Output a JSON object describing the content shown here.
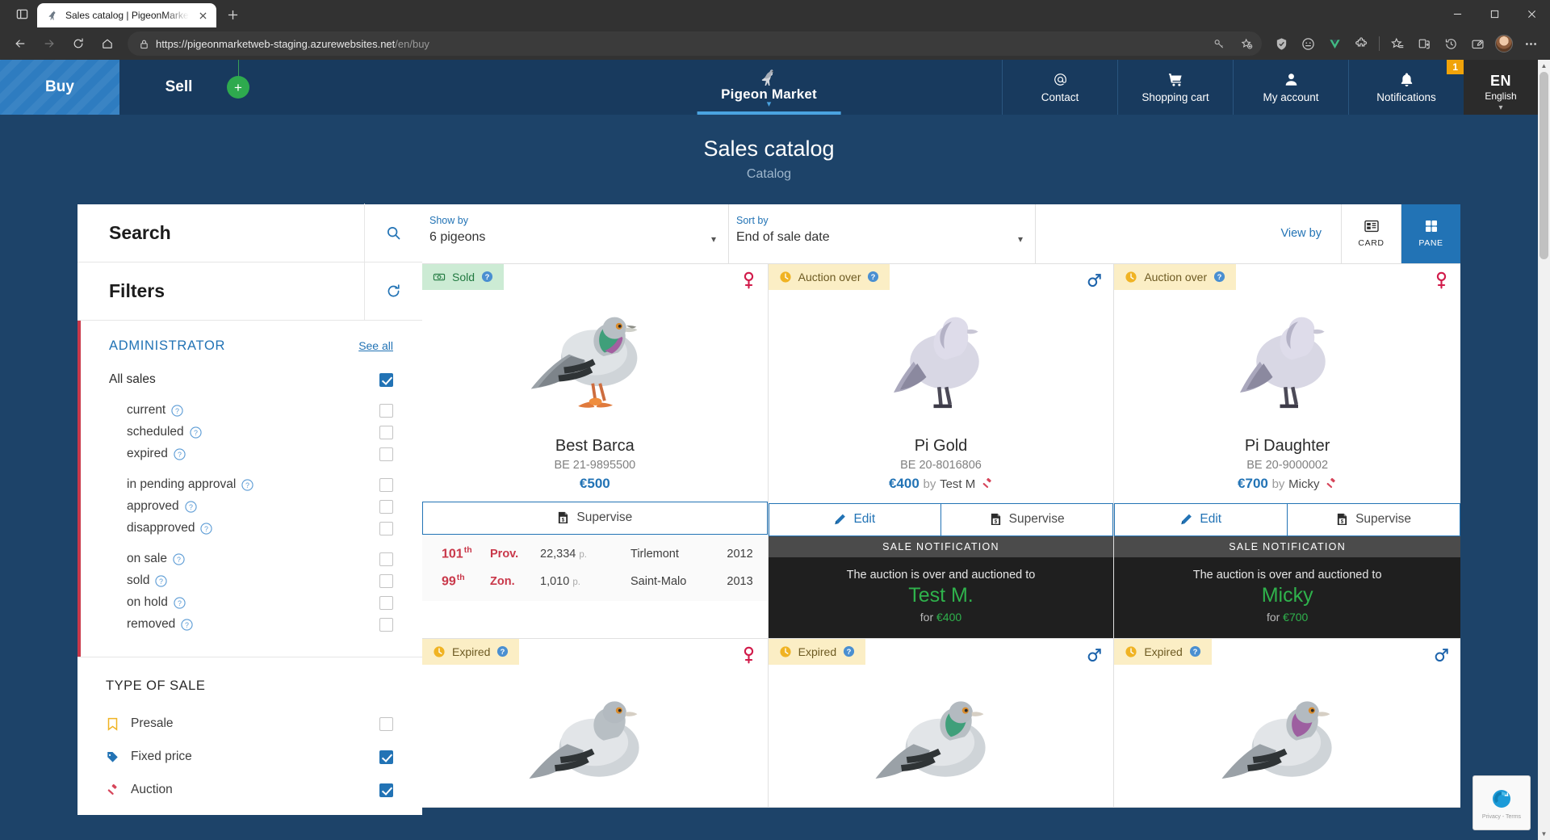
{
  "browser": {
    "tab": {
      "title": "Sales catalog | PigeonMarket - B",
      "favicon": "pigeon-icon"
    },
    "new_tab_label": "+",
    "url_secure": "https://pigeonmarketweb-staging.azurewebsites.net",
    "url_path": "/en/buy",
    "toolbar_icons": [
      "key-icon",
      "add-favorite-icon",
      "shield-icon",
      "emoji-icon",
      "vue-devtools-icon",
      "extensions-icon",
      "favorites-icon",
      "collections-icon",
      "history-icon",
      "screenshot-icon",
      "profile-avatar",
      "more-icon"
    ],
    "window_controls": [
      "minimize",
      "maximize",
      "close"
    ],
    "nav_icons": [
      "back-arrow-icon",
      "forward-arrow-icon",
      "reload-icon",
      "home-icon"
    ]
  },
  "site_nav": {
    "buy": "Buy",
    "sell": "Sell",
    "add_label": "+",
    "brand": "Pigeon Market",
    "items": [
      {
        "label": "Contact",
        "icon": "at-icon"
      },
      {
        "label": "Shopping cart",
        "icon": "cart-icon"
      },
      {
        "label": "My account",
        "icon": "user-icon"
      },
      {
        "label": "Notifications",
        "icon": "bell-icon",
        "badge": "1"
      }
    ],
    "language": {
      "code": "EN",
      "name": "English"
    }
  },
  "page_header": {
    "title": "Sales catalog",
    "subtitle": "Catalog"
  },
  "sidebar": {
    "search": {
      "title": "Search",
      "icon": "search-icon"
    },
    "filters": {
      "title": "Filters",
      "icon": "refresh-icon"
    },
    "administrator": {
      "title": "ADMINISTRATOR",
      "see_all": "See all",
      "all_sales": {
        "label": "All sales",
        "checked": true
      },
      "groups": [
        [
          {
            "label": "current",
            "checked": false
          },
          {
            "label": "scheduled",
            "checked": false
          },
          {
            "label": "expired",
            "checked": false
          }
        ],
        [
          {
            "label": "in pending approval",
            "checked": false
          },
          {
            "label": "approved",
            "checked": false
          },
          {
            "label": "disapproved",
            "checked": false
          }
        ],
        [
          {
            "label": "on sale",
            "checked": false
          },
          {
            "label": "sold",
            "checked": false
          },
          {
            "label": "on hold",
            "checked": false
          },
          {
            "label": "removed",
            "checked": false
          }
        ]
      ]
    },
    "type_of_sale": {
      "title": "TYPE OF SALE",
      "items": [
        {
          "label": "Presale",
          "icon": "bookmark-icon",
          "color": "#f0b323",
          "checked": false
        },
        {
          "label": "Fixed price",
          "icon": "tag-icon",
          "color": "#2273b5",
          "checked": true
        },
        {
          "label": "Auction",
          "icon": "gavel-icon",
          "color": "#d6455a",
          "checked": true
        }
      ]
    }
  },
  "toolbar": {
    "show_by": {
      "label": "Show by",
      "value": "6 pigeons"
    },
    "sort_by": {
      "label": "Sort by",
      "value": "End of sale date"
    },
    "view_by": "View by",
    "modes": [
      {
        "label": "CARD",
        "icon": "card-view-icon",
        "active": false
      },
      {
        "label": "PANE",
        "icon": "pane-view-icon",
        "active": true
      }
    ]
  },
  "cards": [
    {
      "status": {
        "text": "Sold",
        "type": "sold",
        "icon": "handshake-money-icon"
      },
      "gender": "female",
      "bird": "real-photo",
      "name": "Best Barca",
      "ring": "BE 21-9895500",
      "price": "€500",
      "by": null,
      "seller": null,
      "actions": [
        {
          "label": "Supervise",
          "icon": "invoice-icon"
        }
      ],
      "results": [
        {
          "rank": "101",
          "sup": "th",
          "type": "Prov.",
          "pigeons": "22,334",
          "unit": "p.",
          "location": "Tirlemont",
          "year": "2012"
        },
        {
          "rank": "99",
          "sup": "th",
          "type": "Zon.",
          "pigeons": "1,010",
          "unit": "p.",
          "location": "Saint-Malo",
          "year": "2013"
        }
      ],
      "notification": null
    },
    {
      "status": {
        "text": "Auction over",
        "type": "warn",
        "icon": "clock-icon"
      },
      "gender": "male",
      "bird": "placeholder",
      "name": "Pi Gold",
      "ring": "BE 20-8016806",
      "price": "€400",
      "by": "by",
      "seller": "Test M",
      "actions": [
        {
          "label": "Edit",
          "icon": "pencil-icon"
        },
        {
          "label": "Supervise",
          "icon": "invoice-icon"
        }
      ],
      "results": [],
      "notification": {
        "header": "SALE NOTIFICATION",
        "line1": "The auction is over and auctioned to",
        "winner": "Test M.",
        "for_label": "for",
        "amount": "€400"
      }
    },
    {
      "status": {
        "text": "Auction over",
        "type": "warn",
        "icon": "clock-icon"
      },
      "gender": "female",
      "bird": "placeholder",
      "name": "Pi Daughter",
      "ring": "BE 20-9000002",
      "price": "€700",
      "by": "by",
      "seller": "Micky",
      "actions": [
        {
          "label": "Edit",
          "icon": "pencil-icon"
        },
        {
          "label": "Supervise",
          "icon": "invoice-icon"
        }
      ],
      "results": [],
      "notification": {
        "header": "SALE NOTIFICATION",
        "line1": "The auction is over and auctioned to",
        "winner": "Micky",
        "for_label": "for",
        "amount": "€700"
      }
    },
    {
      "status": {
        "text": "Expired",
        "type": "warn",
        "icon": "clock-icon"
      },
      "gender": "female",
      "bird": "real-photo",
      "name": null,
      "ring": null,
      "price": null,
      "by": null,
      "seller": null,
      "actions": [],
      "results": [],
      "notification": null
    },
    {
      "status": {
        "text": "Expired",
        "type": "warn",
        "icon": "clock-icon"
      },
      "gender": "male",
      "bird": "real-photo",
      "name": null,
      "ring": null,
      "price": null,
      "by": null,
      "seller": null,
      "actions": [],
      "results": [],
      "notification": null
    },
    {
      "status": {
        "text": "Expired",
        "type": "warn",
        "icon": "clock-icon"
      },
      "gender": "male",
      "bird": "real-photo",
      "name": null,
      "ring": null,
      "price": null,
      "by": null,
      "seller": null,
      "actions": [],
      "results": [],
      "notification": null
    }
  ],
  "recaptcha": {
    "line1": "Privacy",
    "sep": "-",
    "line2": "Terms"
  },
  "colors": {
    "brand_blue": "#2273b5",
    "nav_dark": "#183a5e",
    "accent_red": "#c9384a",
    "green": "#2fb24c",
    "yellow": "#f0a30a"
  }
}
